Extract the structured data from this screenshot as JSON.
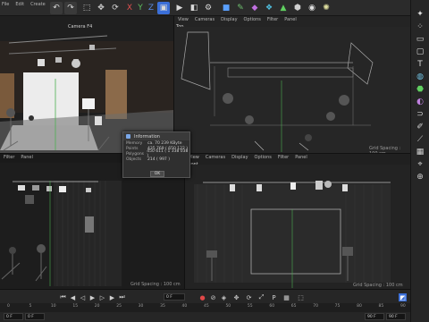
{
  "topbar": {
    "menu": [
      "File",
      "Edit",
      "Create"
    ],
    "axes": [
      "X",
      "Y",
      "Z"
    ],
    "accent": "#3b6fd8"
  },
  "viewports": {
    "perspective": {
      "camera_label": "Camera F4"
    },
    "top": {
      "menu": [
        "View",
        "Cameras",
        "Display",
        "Options",
        "Filter",
        "Panel"
      ],
      "title": "Top",
      "grid": "Grid Spacing : 100 cm"
    },
    "bottom_left": {
      "menu": [
        "Filter",
        "Panel"
      ]
    },
    "front": {
      "menu": [
        "View",
        "Cameras",
        "Display",
        "Options",
        "Filter",
        "Panel"
      ],
      "title": "Front",
      "grid": "Grid Spacing : 100 cm"
    },
    "left": {
      "grid": "Grid Spacing : 100 cm"
    }
  },
  "info_dialog": {
    "title": "Information",
    "rows": [
      {
        "key": "Memory",
        "value": "ca. 70 239 KByte"
      },
      {
        "key": "Points",
        "value": "435 769 ( 650 122 )"
      },
      {
        "key": "Polygons",
        "value": "450 611 ( 1 338 038 )"
      },
      {
        "key": "Objects",
        "value": "214 ( 997 )"
      }
    ],
    "ok_label": "OK"
  },
  "timeline": {
    "start_field": "0 F",
    "current_field": "90 F",
    "end_field": "90 F",
    "ticks": [
      "0",
      "5",
      "10",
      "15",
      "20",
      "25",
      "30",
      "35",
      "40",
      "45",
      "50",
      "55",
      "60",
      "65",
      "70",
      "75",
      "80",
      "85",
      "90"
    ]
  }
}
